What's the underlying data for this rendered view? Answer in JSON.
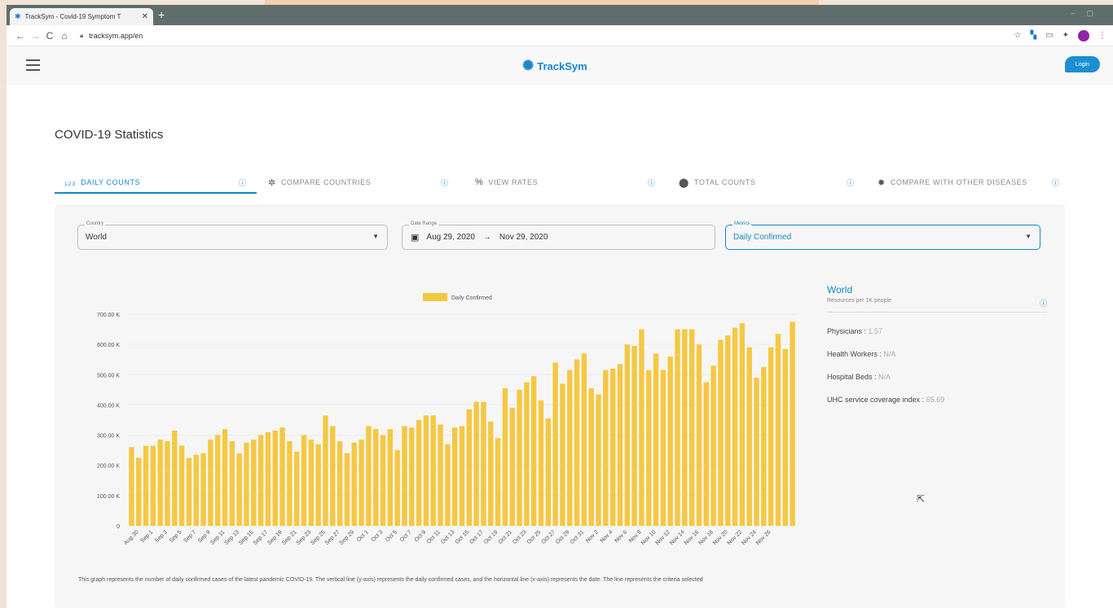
{
  "browser": {
    "tab_title": "TrackSym - Covid-19 Symptom T",
    "url": "tracksym.app/en",
    "close_glyph": "✕",
    "new_tab_glyph": "+"
  },
  "app": {
    "brand": "TrackSym",
    "login_label": "Login"
  },
  "page": {
    "title": "COVID-19 Statistics",
    "tabs": [
      {
        "label": "DAILY COUNTS",
        "icon": "123-icon",
        "active": true
      },
      {
        "label": "COMPARE COUNTRIES",
        "icon": "virus-icon",
        "active": false
      },
      {
        "label": "VIEW RATES",
        "icon": "percent-icon",
        "active": false
      },
      {
        "label": "TOTAL COUNTS",
        "icon": "location-pin-icon",
        "active": false
      },
      {
        "label": "COMPARE WITH OTHER DISEASES",
        "icon": "virus-gear-icon",
        "active": false
      }
    ],
    "filters": {
      "country_label": "Country",
      "country_value": "World",
      "date_label": "Date Range",
      "date_from": "Aug 29, 2020",
      "date_arrow": "→",
      "date_to": "Nov 29, 2020",
      "metric_label": "Metrics",
      "metric_value": "Daily Confirmed"
    },
    "footnote": "This graph represents the number of daily confirmed cases of the latest pandemic COVID-19. The vertical line (y-axis) represents the daily confirmed cases, and the horizontal line (x-axis) represents the date. The line represents the criteria selected",
    "info": {
      "place": "World",
      "subtitle": "Resources per 1K people",
      "rows": [
        {
          "label": "Physicians : ",
          "value": "1.57"
        },
        {
          "label": "Health Workers : ",
          "value": "N/A"
        },
        {
          "label": "Hospital Beds : ",
          "value": "N/A"
        },
        {
          "label": "UHC service coverage index : ",
          "value": "65.69"
        }
      ]
    }
  },
  "colors": {
    "accent": "#1787c9",
    "bar": "#f5c842"
  },
  "chart_data": {
    "type": "bar",
    "title": "",
    "xlabel": "",
    "ylabel": "",
    "legend": "Daily Confirmed",
    "legend_position": "top-center",
    "ylim": [
      0,
      700000
    ],
    "yticks": [
      "0",
      "100.00 K",
      "200.00 K",
      "300.00 K",
      "400.00 K",
      "500.00 K",
      "600.00 K",
      "700.00 K"
    ],
    "x_tick_labels": [
      "Aug 30",
      "Sep 1",
      "Sep 3",
      "Sep 5",
      "Sep 7",
      "Sep 9",
      "Sep 11",
      "Sep 13",
      "Sep 15",
      "Sep 17",
      "Sep 19",
      "Sep 21",
      "Sep 23",
      "Sep 25",
      "Sep 27",
      "Sep 29",
      "Oct 1",
      "Oct 3",
      "Oct 5",
      "Oct 7",
      "Oct 9",
      "Oct 11",
      "Oct 13",
      "Oct 15",
      "Oct 17",
      "Oct 19",
      "Oct 21",
      "Oct 23",
      "Oct 25",
      "Oct 27",
      "Oct 29",
      "Oct 31",
      "Nov 2",
      "Nov 4",
      "Nov 6",
      "Nov 8",
      "Nov 10",
      "Nov 12",
      "Nov 14",
      "Nov 16",
      "Nov 18",
      "Nov 20",
      "Nov 22",
      "Nov 24",
      "Nov 26"
    ],
    "start_label": "Aug 29",
    "series": [
      {
        "name": "Daily Confirmed",
        "values": [
          260000,
          225000,
          265000,
          265000,
          285000,
          280000,
          315000,
          265000,
          225000,
          235000,
          240000,
          285000,
          300000,
          320000,
          280000,
          240000,
          275000,
          285000,
          300000,
          310000,
          315000,
          325000,
          280000,
          245000,
          300000,
          285000,
          270000,
          365000,
          330000,
          280000,
          240000,
          275000,
          285000,
          330000,
          320000,
          300000,
          320000,
          250000,
          330000,
          325000,
          350000,
          365000,
          365000,
          335000,
          270000,
          325000,
          330000,
          385000,
          410000,
          410000,
          345000,
          290000,
          455000,
          390000,
          450000,
          475000,
          495000,
          415000,
          355000,
          540000,
          470000,
          515000,
          550000,
          570000,
          455000,
          435000,
          515000,
          520000,
          535000,
          600000,
          595000,
          650000,
          515000,
          570000,
          515000,
          560000,
          650000,
          650000,
          650000,
          600000,
          475000,
          530000,
          615000,
          630000,
          655000,
          670000,
          590000,
          490000,
          525000,
          590000,
          635000,
          585000,
          675000
        ]
      }
    ]
  }
}
